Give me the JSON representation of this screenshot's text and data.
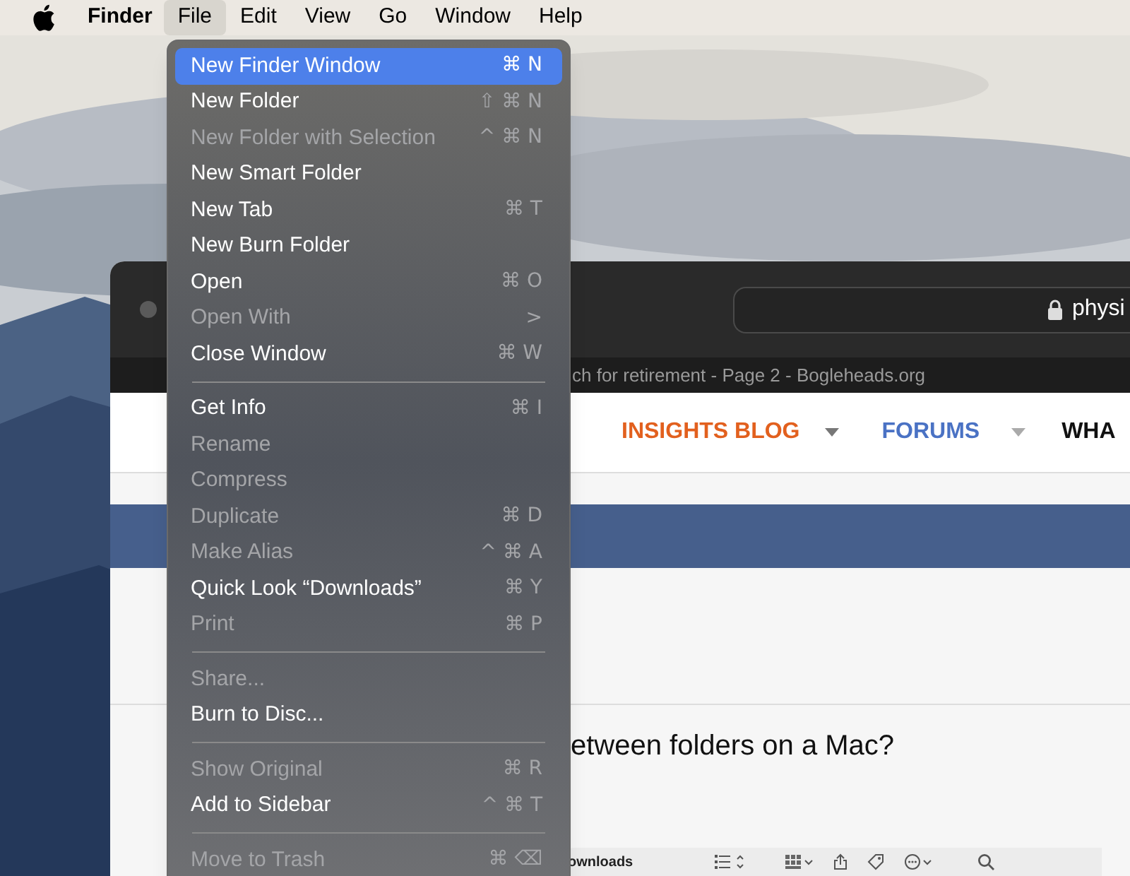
{
  "menu_bar": {
    "items": [
      {
        "label": "Finder",
        "kind": "app",
        "selected": false
      },
      {
        "label": "File",
        "kind": "menu",
        "selected": true
      },
      {
        "label": "Edit",
        "kind": "menu",
        "selected": false
      },
      {
        "label": "View",
        "kind": "menu",
        "selected": false
      },
      {
        "label": "Go",
        "kind": "menu",
        "selected": false
      },
      {
        "label": "Window",
        "kind": "menu",
        "selected": false
      },
      {
        "label": "Help",
        "kind": "menu",
        "selected": false
      }
    ]
  },
  "file_menu": {
    "items": [
      {
        "kind": "item",
        "label": "New Finder Window",
        "shortcut": "⌘ N",
        "disabled": false,
        "selected": true
      },
      {
        "kind": "item",
        "label": "New Folder",
        "shortcut": "⇧ ⌘ N",
        "disabled": false,
        "selected": false
      },
      {
        "kind": "item",
        "label": "New Folder with Selection",
        "shortcut": "^ ⌘ N",
        "disabled": true,
        "selected": false
      },
      {
        "kind": "item",
        "label": "New Smart Folder",
        "disabled": false,
        "selected": false
      },
      {
        "kind": "item",
        "label": "New Tab",
        "shortcut": "⌘ T",
        "disabled": false,
        "selected": false
      },
      {
        "kind": "item",
        "label": "New Burn Folder",
        "disabled": false,
        "selected": false
      },
      {
        "kind": "item",
        "label": "Open",
        "shortcut": "⌘ O",
        "disabled": false,
        "selected": false
      },
      {
        "kind": "item",
        "label": "Open With",
        "shortcut": ">",
        "disabled": true,
        "selected": false
      },
      {
        "kind": "item",
        "label": "Close Window",
        "shortcut": "⌘ W",
        "disabled": false,
        "selected": false
      },
      {
        "kind": "separator"
      },
      {
        "kind": "item",
        "label": "Get Info",
        "shortcut": "⌘ I",
        "disabled": false,
        "selected": false
      },
      {
        "kind": "item",
        "label": "Rename",
        "disabled": true,
        "selected": false
      },
      {
        "kind": "item",
        "label": "Compress",
        "disabled": true,
        "selected": false
      },
      {
        "kind": "item",
        "label": "Duplicate",
        "shortcut": "⌘ D",
        "disabled": true,
        "selected": false
      },
      {
        "kind": "item",
        "label": "Make Alias",
        "shortcut": "^ ⌘ A",
        "disabled": true,
        "selected": false
      },
      {
        "kind": "item",
        "label": "Quick Look “Downloads”",
        "shortcut": "⌘ Y",
        "disabled": false,
        "selected": false
      },
      {
        "kind": "item",
        "label": "Print",
        "shortcut": "⌘ P",
        "disabled": true,
        "selected": false
      },
      {
        "kind": "separator"
      },
      {
        "kind": "item",
        "label": "Share...",
        "disabled": true,
        "selected": false
      },
      {
        "kind": "item",
        "label": "Burn to Disc...",
        "disabled": false,
        "selected": false
      },
      {
        "kind": "separator"
      },
      {
        "kind": "item",
        "label": "Show Original",
        "shortcut": "⌘ R",
        "disabled": true,
        "selected": false
      },
      {
        "kind": "item",
        "label": "Add to Sidebar",
        "shortcut": "^ ⌘ T",
        "disabled": false,
        "selected": false
      },
      {
        "kind": "separator"
      },
      {
        "kind": "item",
        "label": "Move to Trash",
        "shortcut": "⌘ ⌫",
        "disabled": true,
        "selected": false
      }
    ]
  },
  "browser": {
    "address": "physi",
    "tab_title": "ch for retirement - Page 2 - Bogleheads.org",
    "nav": [
      {
        "label": "INSIGHTS BLOG",
        "color": "#e2601e"
      },
      {
        "label": "FORUMS",
        "color": "#4a72c4"
      },
      {
        "label": "WHA",
        "color": "#111111"
      }
    ],
    "question": "etween folders on a Mac?"
  },
  "finder_toolbar": {
    "folder": "ownloads"
  }
}
